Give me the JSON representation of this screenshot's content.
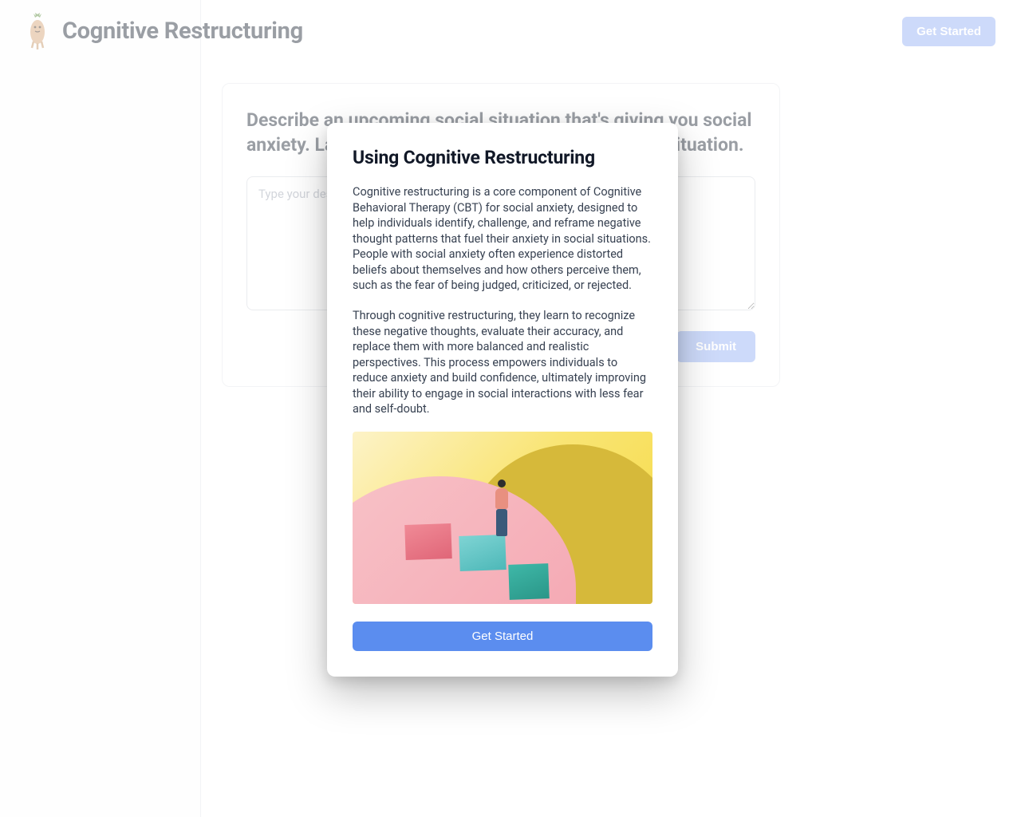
{
  "header": {
    "title": "Cognitive Restructuring",
    "get_started_label": "Get Started"
  },
  "main": {
    "prompt_heading": "Describe an upcoming social situation that's giving you social anxiety. Lacking that, describe a recent past social situation.",
    "placeholder": "Type your description here.",
    "value": "",
    "submit_label": "Submit"
  },
  "modal": {
    "title": "Using Cognitive Restructuring",
    "paragraph_1": "Cognitive restructuring is a core component of Cognitive Behavioral Therapy (CBT) for social anxiety, designed to help individuals identify, challenge, and reframe negative thought patterns that fuel their anxiety in social situations. People with social anxiety often experience distorted beliefs about themselves and how others perceive them, such as the fear of being judged, criticized, or rejected.",
    "paragraph_2": "Through cognitive restructuring, they learn to recognize these negative thoughts, evaluate their accuracy, and replace them with more balanced and realistic perspectives. This process empowers individuals to reduce anxiety and build confidence, ultimately improving their ability to engage in social interactions with less fear and self-doubt.",
    "button_label": "Get Started"
  }
}
